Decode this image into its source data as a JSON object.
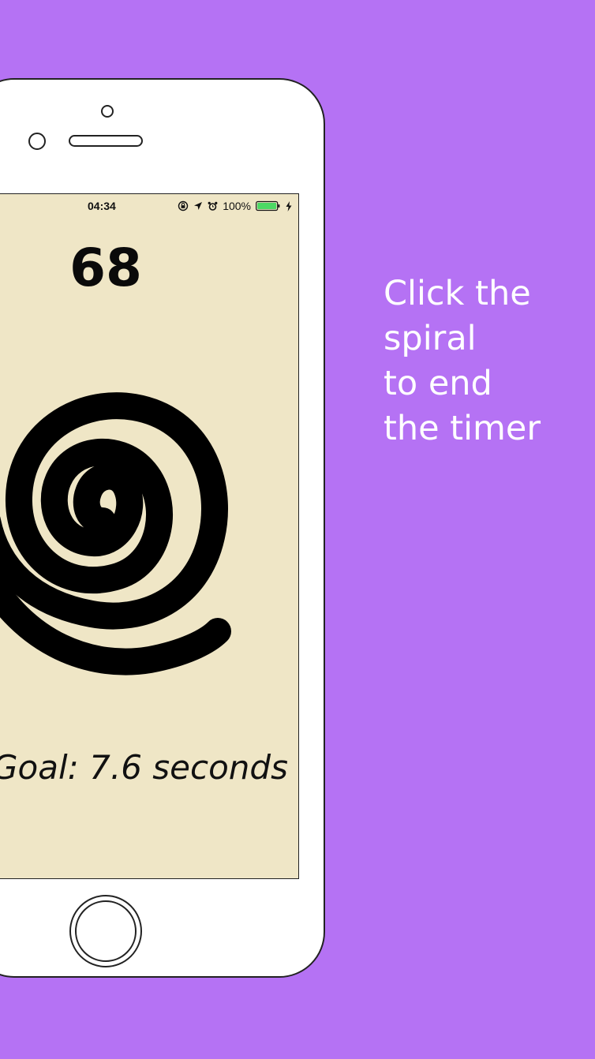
{
  "status_bar": {
    "time": "04:34",
    "battery": "100%",
    "icons": [
      "rotation-lock-icon",
      "location-arrow-icon",
      "alarm-clock-icon",
      "battery-icon",
      "charging-bolt-icon"
    ]
  },
  "timer": {
    "count": "68",
    "goal": "Goal: 7.6 seconds"
  },
  "caption": {
    "lines": [
      "Click the",
      "spiral",
      "to end",
      "the timer"
    ]
  },
  "colors": {
    "background": "#b572f4",
    "screen": "#efe6c6",
    "spiral": "#000000",
    "battery_fill": "#4cd964",
    "caption_text": "#ffffff"
  }
}
